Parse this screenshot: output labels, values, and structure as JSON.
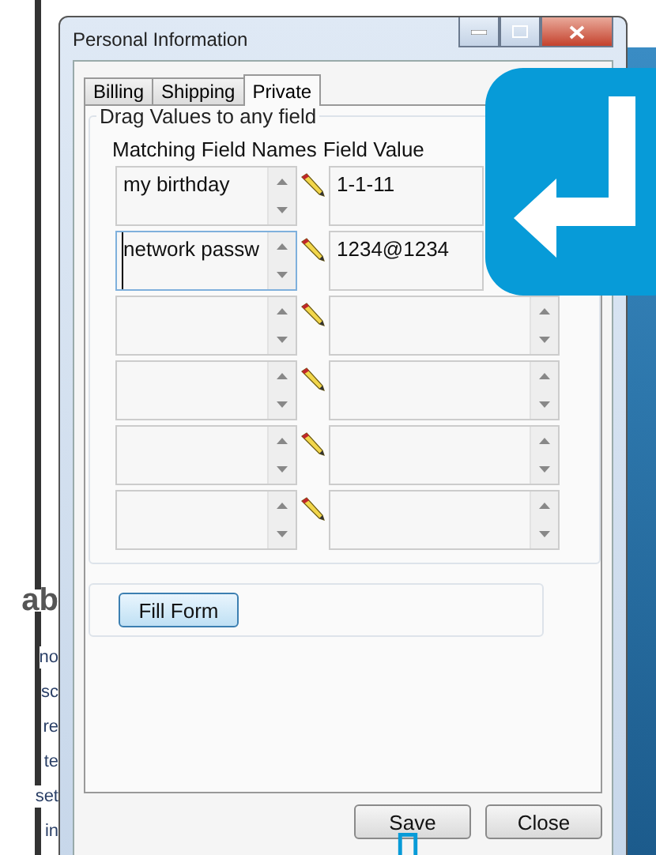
{
  "window": {
    "title": "Personal Information"
  },
  "tabs": [
    {
      "label": "Billing",
      "selected": false
    },
    {
      "label": "Shipping",
      "selected": false
    },
    {
      "label": "Private",
      "selected": true
    }
  ],
  "group": {
    "title": "Drag Values to any field",
    "columns": [
      "Matching Field Names",
      "Field Value"
    ]
  },
  "rows": [
    {
      "name": "my birthday",
      "value": "1-1-11",
      "focused": false
    },
    {
      "name": "network passw",
      "value": "1234@1234",
      "focused": true
    },
    {
      "name": "",
      "value": "",
      "focused": false
    },
    {
      "name": "",
      "value": "",
      "focused": false
    },
    {
      "name": "",
      "value": "",
      "focused": false
    },
    {
      "name": "",
      "value": "",
      "focused": false
    }
  ],
  "fill_button": "Fill Form",
  "buttons": [
    "Save",
    "Close"
  ],
  "background_fragments": [
    "ab",
    "no",
    "sc",
    "re",
    "te",
    "set",
    "in"
  ]
}
